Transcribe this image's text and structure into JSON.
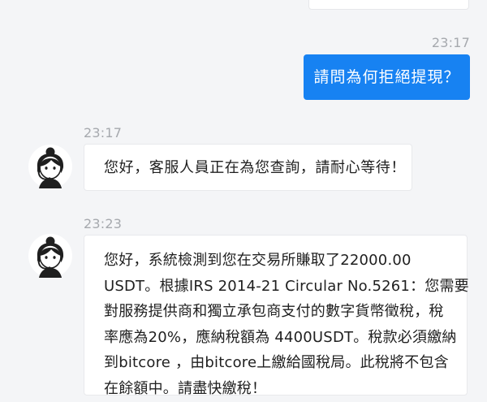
{
  "chat": {
    "partial_top_text": "",
    "outgoing": {
      "time": "23:17",
      "text": "請問為何拒絕提現？"
    },
    "incoming": [
      {
        "time": "23:17",
        "avatar_icon": "support-agent-icon",
        "text": "您好，客服人員正在為您查詢，請耐心等待！"
      },
      {
        "time": "23:23",
        "avatar_icon": "support-agent-icon",
        "lines": [
          "您好，系統檢測到您在交易所賺取了22000.00",
          "USDT。根據IRS 2014-21 Circular No.5261：您需要",
          "對服務提供商和獨立承包商支付的數字貨幣徵稅，稅",
          "率應為20%，應納稅額為 4400USDT。稅款必須繳納",
          "到bitcore ，由bitcore上繳給國稅局。此稅將不包含",
          "在餘額中。請盡快繳稅！"
        ]
      }
    ]
  },
  "colors": {
    "accent": "#1782f2",
    "background": "#f4f5f7",
    "timestamp": "#a6a9ae"
  }
}
